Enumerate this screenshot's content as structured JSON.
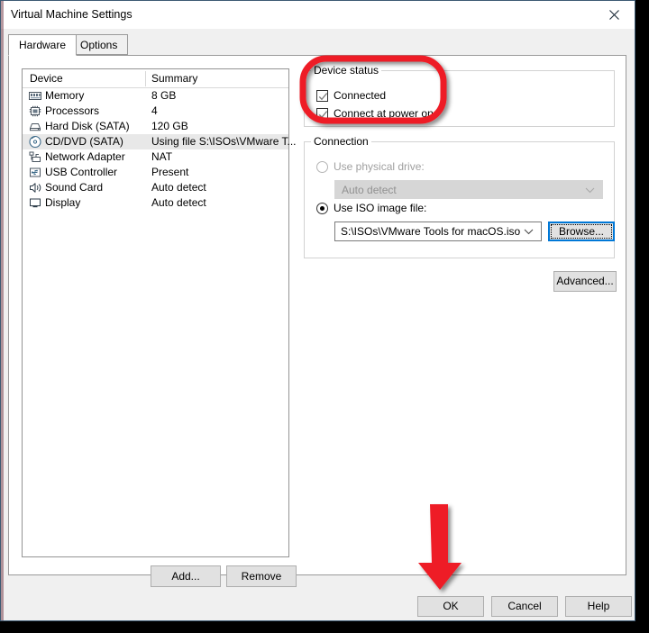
{
  "window": {
    "title": "Virtual Machine Settings",
    "close_icon": "close-icon"
  },
  "tabs": [
    {
      "label": "Hardware",
      "selected": true
    },
    {
      "label": "Options",
      "selected": false
    }
  ],
  "device_list": {
    "columns": [
      "Device",
      "Summary"
    ],
    "rows": [
      {
        "icon": "memory-icon",
        "device": "Memory",
        "summary": "8 GB",
        "selected": false
      },
      {
        "icon": "processor-icon",
        "device": "Processors",
        "summary": "4",
        "selected": false
      },
      {
        "icon": "hard-disk-icon",
        "device": "Hard Disk (SATA)",
        "summary": "120 GB",
        "selected": false
      },
      {
        "icon": "cd-dvd-icon",
        "device": "CD/DVD (SATA)",
        "summary": "Using file S:\\ISOs\\VMware T...",
        "selected": true
      },
      {
        "icon": "network-adapter-icon",
        "device": "Network Adapter",
        "summary": "NAT",
        "selected": false
      },
      {
        "icon": "usb-controller-icon",
        "device": "USB Controller",
        "summary": "Present",
        "selected": false
      },
      {
        "icon": "sound-card-icon",
        "device": "Sound Card",
        "summary": "Auto detect",
        "selected": false
      },
      {
        "icon": "display-icon",
        "device": "Display",
        "summary": "Auto detect",
        "selected": false
      }
    ],
    "add_label": "Add...",
    "remove_label": "Remove"
  },
  "device_status": {
    "legend": "Device status",
    "connected": {
      "label": "Connected",
      "checked": true
    },
    "connect_at_power_on": {
      "label": "Connect at power on",
      "checked": true
    }
  },
  "connection": {
    "legend": "Connection",
    "use_physical_drive": {
      "label": "Use physical drive:",
      "selected": false,
      "disabled": true
    },
    "physical_drive_value": "Auto detect",
    "use_iso_image": {
      "label": "Use ISO image file:",
      "selected": true,
      "disabled": false
    },
    "iso_path_value": "S:\\ISOs\\VMware Tools for macOS.iso",
    "browse_label": "Browse...",
    "advanced_label": "Advanced..."
  },
  "footer": {
    "ok_label": "OK",
    "cancel_label": "Cancel",
    "help_label": "Help"
  },
  "annotations": {
    "highlight_color": "#ee1c25",
    "oval": {
      "target": "device-status-checkboxes",
      "shape": "rounded-rectangle"
    },
    "arrow": {
      "target": "ok-button",
      "direction": "down"
    }
  }
}
